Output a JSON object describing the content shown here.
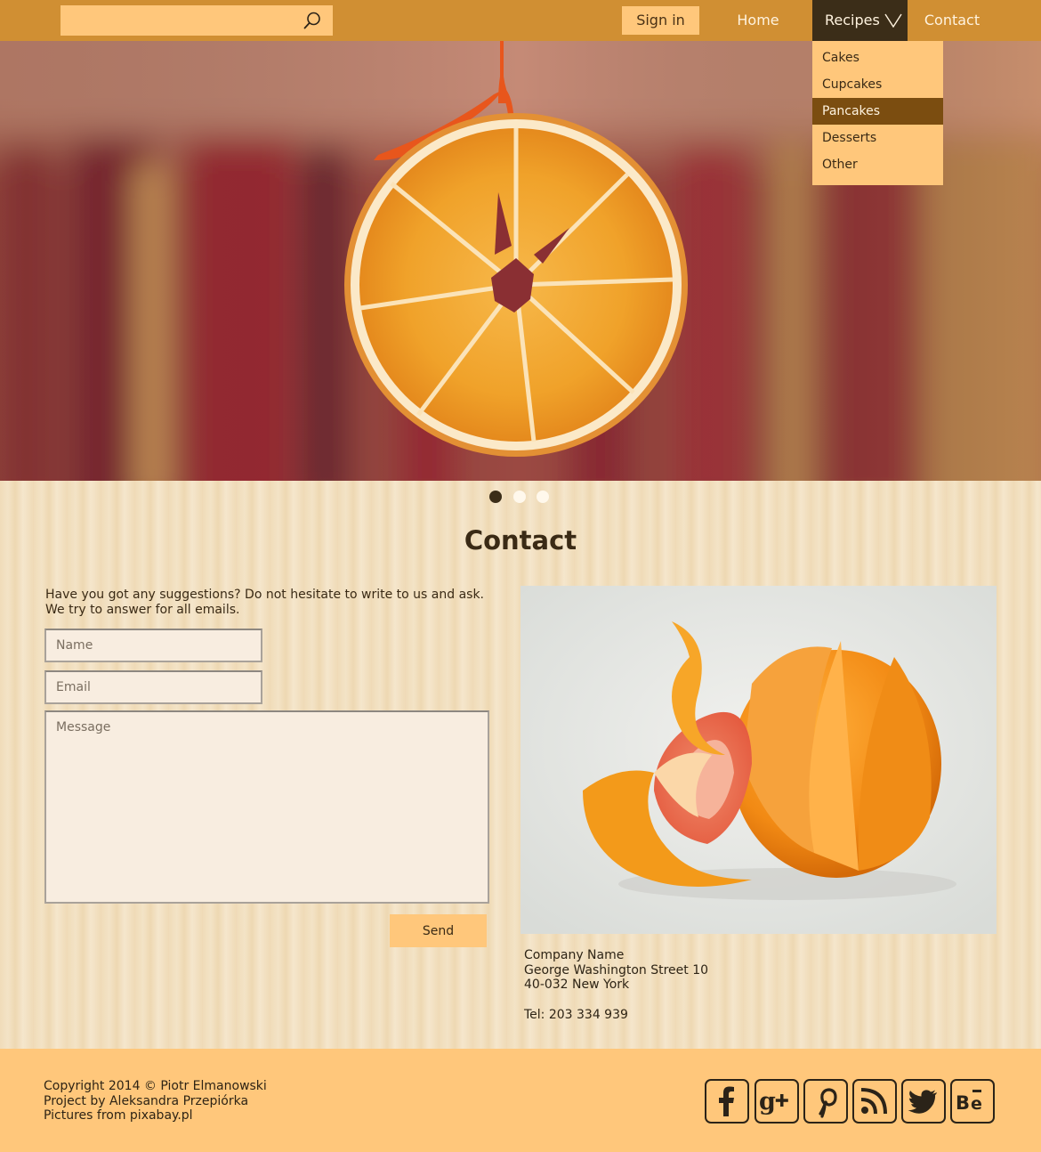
{
  "search": {
    "placeholder": "",
    "icon": "search-icon"
  },
  "header": {
    "signin_label": "Sign in",
    "nav": {
      "home": "Home",
      "recipes": "Recipes",
      "contact": "Contact"
    }
  },
  "recipes_menu": [
    "Cakes",
    "Cupcakes",
    "Pancakes",
    "Desserts",
    "Other"
  ],
  "recipes_menu_active": "Pancakes",
  "slider": {
    "slides": 3,
    "active": 1
  },
  "contact": {
    "title": "Contact",
    "intro_line1": "Have you got any suggestions? Do not hesitate to write to us and ask.",
    "intro_line2": "We try to answer for all emails.",
    "name_placeholder": "Name",
    "email_placeholder": "Email",
    "message_placeholder": "Message",
    "send_label": "Send"
  },
  "address": {
    "company": "Company Name",
    "street": "George Washington Street 10",
    "city": "40-032 New York",
    "tel": "Tel: 203 334 939"
  },
  "footer": {
    "copyright": "Copyright 2014 © Piotr Elmanowski",
    "project": "Project by Aleksandra Przepiórka",
    "pictures": "Pictures from pixabay.pl",
    "social": [
      "facebook-icon",
      "google-plus-icon",
      "pinterest-icon",
      "rss-icon",
      "twitter-icon",
      "behance-icon"
    ]
  },
  "colors": {
    "header_bg": "#d08f33",
    "accent_light": "#ffc77b",
    "nav_active_bg": "#3b2d18",
    "menu_active_bg": "#7b4d10"
  }
}
